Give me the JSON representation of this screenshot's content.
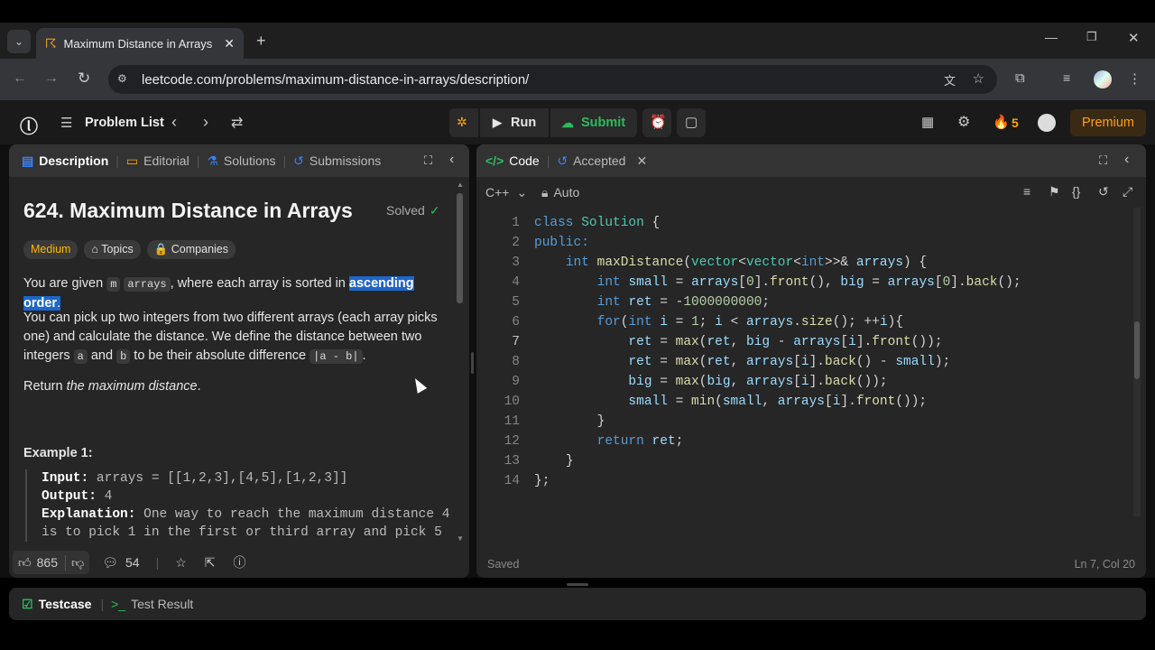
{
  "browser": {
    "tab_title": "Maximum Distance in Arrays",
    "url": "leetcode.com/problems/maximum-distance-in-arrays/description/"
  },
  "header": {
    "problem_list": "Problem List",
    "run": "Run",
    "submit": "Submit",
    "streak": "5",
    "premium": "Premium"
  },
  "left": {
    "tabs": [
      "Description",
      "Editorial",
      "Solutions",
      "Submissions"
    ],
    "title": "624. Maximum Distance in Arrays",
    "solved": "Solved",
    "difficulty": "Medium",
    "topics": "Topics",
    "companies": "Companies",
    "p1_a": "You are given ",
    "p1_m": "m",
    "p1_arrays": "arrays",
    "p1_b": ", where each array is sorted in ",
    "p1_hl": "ascending order",
    "p1_c": ".",
    "p2_a": "You can pick up two integers from two different arrays (each array picks one) and calculate the distance. We define the distance between two integers ",
    "p2_a_code": "a",
    "p2_and": " and ",
    "p2_b_code": "b",
    "p2_b": " to be their absolute difference ",
    "p2_abs": "|a - b|",
    "p2_end": ".",
    "p3_a": "Return ",
    "p3_em": "the maximum distance",
    "p3_end": ".",
    "example_title": "Example 1:",
    "ex_input_lbl": "Input:",
    "ex_input": " arrays = [[1,2,3],[4,5],[1,2,3]]",
    "ex_output_lbl": "Output:",
    "ex_output": " 4",
    "ex_expl_lbl": "Explanation:",
    "ex_expl": " One way to reach the maximum distance 4",
    "ex_expl2": "is to pick 1 in the first or third array and pick 5",
    "likes": "865",
    "comments": "54"
  },
  "right": {
    "code_tab": "Code",
    "accepted_tab": "Accepted",
    "language": "C++",
    "auto": "Auto",
    "saved": "Saved",
    "cursor": "Ln 7, Col 20",
    "line_numbers": [
      "1",
      "2",
      "3",
      "4",
      "5",
      "6",
      "7",
      "8",
      "9",
      "10",
      "11",
      "12",
      "13",
      "14"
    ]
  },
  "bottom": {
    "testcase": "Testcase",
    "result": "Test Result"
  },
  "colors": {
    "accent_green": "#2cbb5d",
    "premium": "#ffa116",
    "highlight": "#1e66c8",
    "medium": "#ffb800"
  }
}
